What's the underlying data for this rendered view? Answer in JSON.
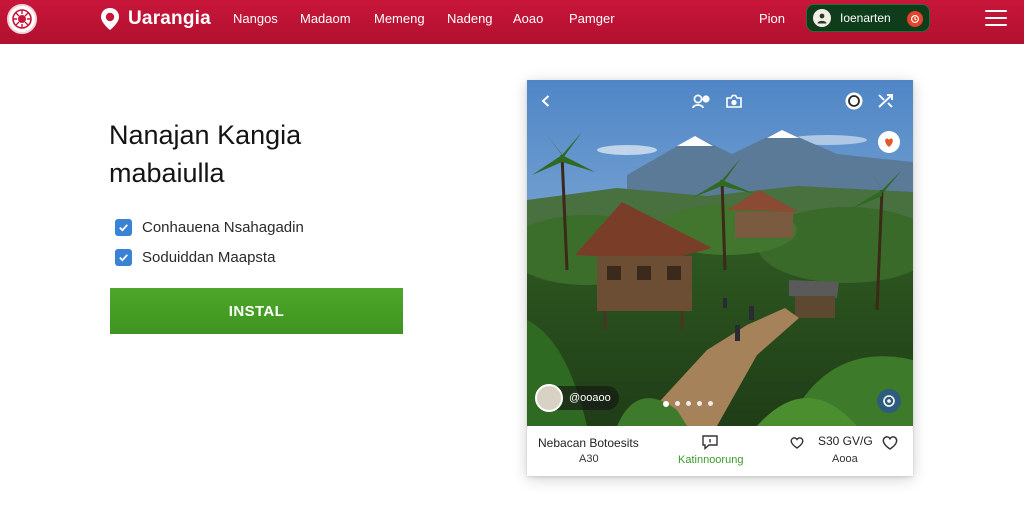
{
  "header": {
    "brand_name": "Uarangia",
    "nav_items": [
      "Nangos",
      "Madaom",
      "Memeng",
      "Nadeng",
      "Aoao",
      "Pamger"
    ],
    "price_label": "Pion",
    "user_name": "Ioenarten",
    "accent_color": "#c8163a"
  },
  "main": {
    "headline_line1": "Nanajan Kangia",
    "headline_line2": "mabaiulla",
    "options": [
      {
        "label": "Conhauena Nsahagadin",
        "checked": true
      },
      {
        "label": "Soduiddan Maapsta",
        "checked": true
      }
    ],
    "install_label": "INSTAL",
    "install_color": "#4ea72a"
  },
  "card": {
    "chip_label": "@ooaoo",
    "footer_title": "Nebacan Botoesits",
    "footer_sub": "A30",
    "footer_link": "Katinnoorung",
    "footer_count": "S30 GV/G",
    "footer_sub2": "Aooa"
  }
}
